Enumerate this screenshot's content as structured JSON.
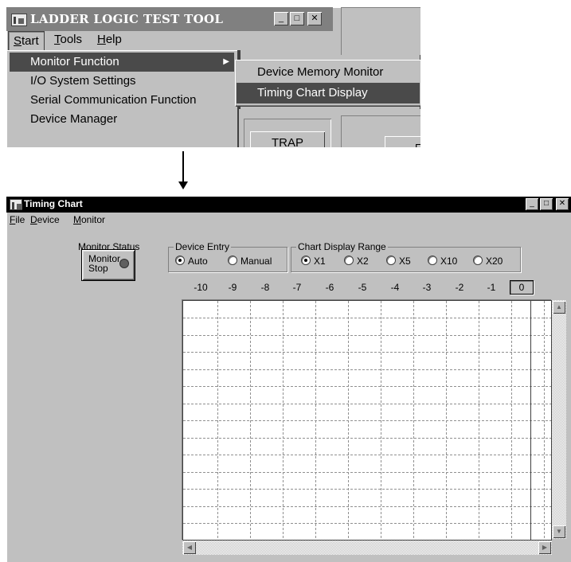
{
  "top_window": {
    "title": "LADDER LOGIC TEST TOOL",
    "caption_buttons": [
      "_",
      "□",
      "✕"
    ],
    "menu": [
      {
        "label_u": "S",
        "label_rest": "tart"
      },
      {
        "label_u": "T",
        "label_rest": "ools"
      },
      {
        "label_u": "H",
        "label_rest": "elp"
      }
    ],
    "dropdown": [
      {
        "label": "Monitor Function",
        "arrow": "▶"
      },
      {
        "label": "I/O System Settings"
      },
      {
        "label": "Serial Communication Function"
      },
      {
        "label": "Device Manager"
      }
    ],
    "submenu": [
      {
        "label": "Device Memory Monitor"
      },
      {
        "label": "Timing Chart Display"
      }
    ],
    "trap_button": "TRAP",
    "f_button": "F"
  },
  "timing_chart": {
    "title": "Timing Chart",
    "caption_buttons": [
      "_",
      "□",
      "✕"
    ],
    "menu": [
      {
        "label_u": "F",
        "label_rest": "ile"
      },
      {
        "label_u": "D",
        "label_rest": "evice"
      },
      {
        "label_u": "M",
        "label_rest": "onitor"
      }
    ],
    "monitor_status": {
      "label": "Monitor Status",
      "button_line1": "Monitor",
      "button_line2": "Stop"
    },
    "device_entry": {
      "label": "Device Entry",
      "options": [
        {
          "label": "Auto",
          "selected": true
        },
        {
          "label": "Manual",
          "selected": false
        }
      ]
    },
    "display_range": {
      "label": "Chart Display Range",
      "options": [
        {
          "label": "X1",
          "selected": true
        },
        {
          "label": "X2",
          "selected": false
        },
        {
          "label": "X5",
          "selected": false
        },
        {
          "label": "X10",
          "selected": false
        },
        {
          "label": "X20",
          "selected": false
        }
      ]
    },
    "ticks": [
      "-10",
      "-9",
      "-8",
      "-7",
      "-6",
      "-5",
      "-4",
      "-3",
      "-2",
      "-1",
      "0"
    ],
    "scroll_arrows": {
      "up": "▲",
      "down": "▼",
      "left": "◀",
      "right": "▶"
    }
  }
}
